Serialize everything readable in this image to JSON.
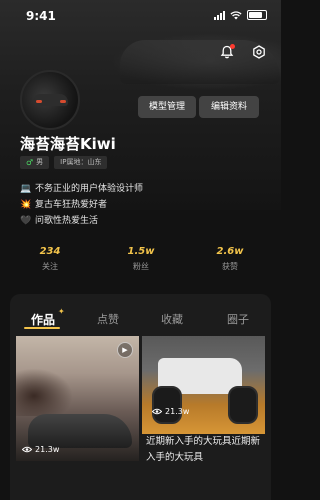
{
  "status_bar": {
    "time": "9:41"
  },
  "profile": {
    "name": "海苔海苔Kiwi",
    "gender": "男",
    "ip_location": "IP属地：山东",
    "bio": [
      {
        "emoji": "💻",
        "text": "不务正业的用户体验设计师"
      },
      {
        "emoji": "💥",
        "text": "复古车狂热爱好者"
      },
      {
        "emoji": "🖤",
        "text": "问歌性热爱生活"
      }
    ]
  },
  "buttons": {
    "model_manage": "模型管理",
    "edit_profile": "编辑资料"
  },
  "stats": [
    {
      "value": "234",
      "label": "关注"
    },
    {
      "value": "1.5w",
      "label": "粉丝"
    },
    {
      "value": "2.6w",
      "label": "获赞"
    }
  ],
  "tabs": [
    {
      "label": "作品"
    },
    {
      "label": "点赞"
    },
    {
      "label": "收藏"
    },
    {
      "label": "圈子"
    }
  ],
  "posts": [
    {
      "views": "21.3w"
    },
    {
      "views": "21.3w",
      "title": "近期新入手的大玩具近期新入手的大玩具"
    }
  ],
  "colors": {
    "accent": "#f3c44b",
    "notification_dot": "#ff3b30",
    "gender": "#4cd964"
  },
  "icons": [
    "bell-icon",
    "gear-icon",
    "play-icon",
    "eye-icon",
    "sparkle-icon"
  ]
}
